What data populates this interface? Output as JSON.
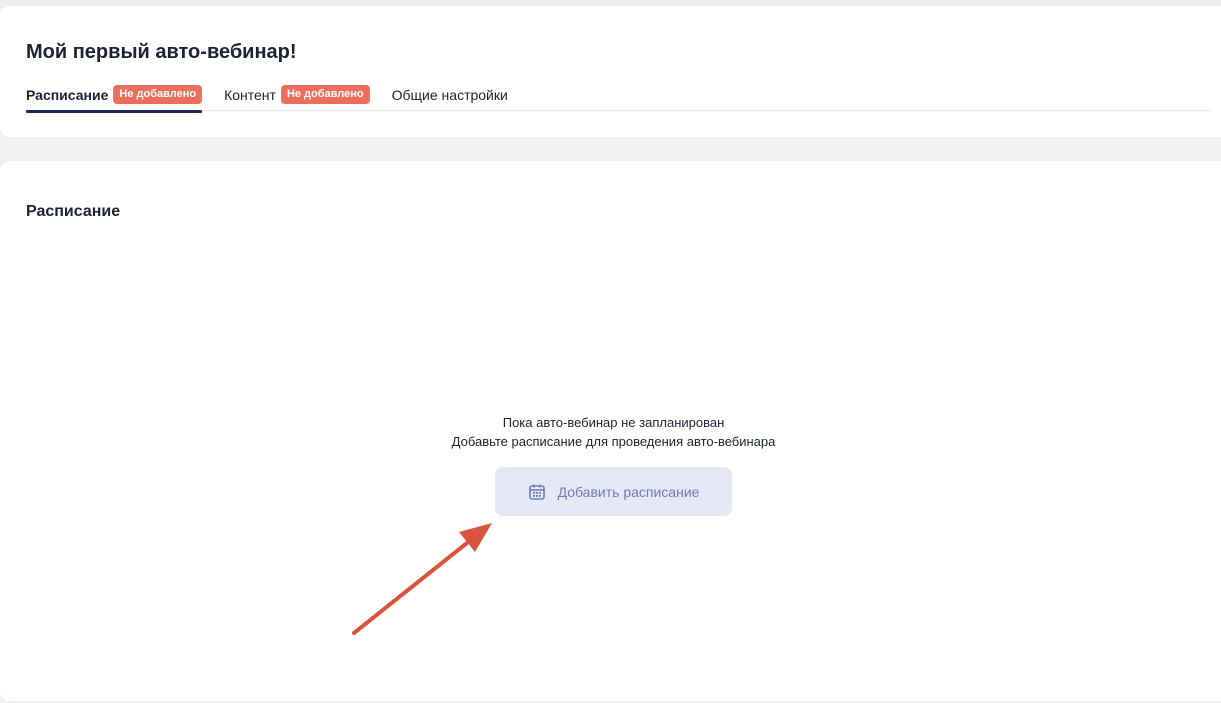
{
  "header": {
    "title": "Мой первый авто-вебинар!",
    "tabs": [
      {
        "label": "Расписание",
        "badge": "Не добавлено",
        "active": true
      },
      {
        "label": "Контент",
        "badge": "Не добавлено",
        "active": false
      },
      {
        "label": "Общие настройки",
        "active": false
      }
    ]
  },
  "schedule": {
    "title": "Расписание",
    "empty_line1": "Пока авто-вебинар не запланирован",
    "empty_line2": "Добавьте расписание для проведения авто-вебинара",
    "add_button": {
      "label": "Добавить расписание",
      "icon": "calendar-icon"
    }
  },
  "annotation": {
    "arrow_color": "#d9533f"
  },
  "colors": {
    "badge": "#ec6f5d",
    "active_tab_underline": "#1c2a5c",
    "button_bg": "#e6e9f5",
    "button_text": "#6d7cb5",
    "page_bg": "#f0f0f1"
  }
}
